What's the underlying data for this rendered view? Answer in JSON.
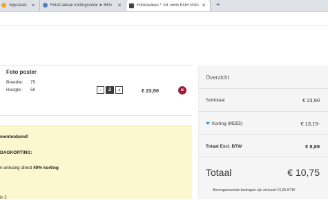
{
  "tabs": [
    {
      "title": "SpyDeals",
      "favicon_color": "#f5a623"
    },
    {
      "title": "FotoCadeau kortingscode ➤ 64%",
      "favicon_color": "#4a7fc1"
    },
    {
      "title": "Fotocadeau * Tot -55% KORTING",
      "favicon_color": "#444444"
    }
  ],
  "new_tab_label": "+",
  "close_glyph": "✕",
  "cart": {
    "item": {
      "title": "Foto poster",
      "width_label": "Breedte:",
      "width_value": "75",
      "height_label": "Hoogte:",
      "height_value": "50",
      "quantity": "2",
      "minus": "-",
      "plus": "+",
      "price": "€ 23,90",
      "remove_glyph": "×"
    }
  },
  "promo": {
    "line1": "mentenbond!",
    "line2": "DAGKORTING:",
    "line3_prefix": "n ontvang direct ",
    "line3_bold": "40% korting",
    "line4": "in 2"
  },
  "summary": {
    "heading": "Overzicht",
    "subtotal_label": "Subtotaal",
    "subtotal_value": "€ 23,90",
    "discount_label": "Korting (MD55)",
    "discount_value": "€ 13,15-",
    "excl_label": "Totaal Excl. BTW",
    "excl_value": "€ 8,89",
    "total_label": "Totaal",
    "total_value": "€ 10,75",
    "note": "Bovengenoemde bedragen zijn inclusief €1,86 BTW"
  },
  "colors": {
    "remove_button": "#9b1c3a",
    "promo_background": "#fbf8d0",
    "discount_caret": "#3a8fd1"
  }
}
